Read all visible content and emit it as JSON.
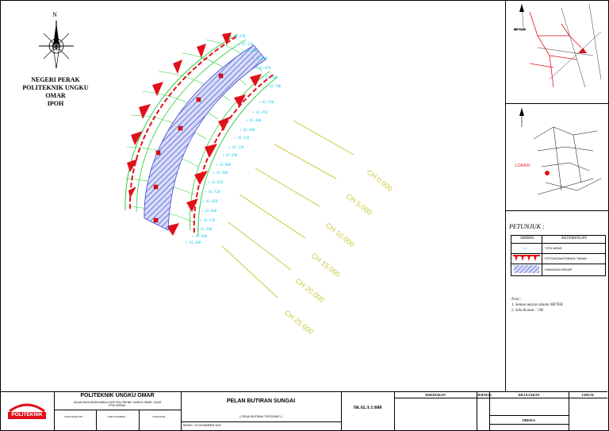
{
  "org_block": {
    "line1": "NEGERI PERAK",
    "line2": "POLITEKNIK UNGKU",
    "line3": "OMAR",
    "line4": "IPOH"
  },
  "chainages": [
    {
      "label": "CH 0.000"
    },
    {
      "label": "CH 5.000"
    },
    {
      "label": "CH 10.000"
    },
    {
      "label": "CH 15.000"
    },
    {
      "label": "CH 20.000"
    },
    {
      "label": "CH 25.000"
    }
  ],
  "location_label": "LOKASI",
  "legend": {
    "title": "PETUNJUK :",
    "header_symbol": "SIMBOL",
    "header_desc": "KETERANGAN",
    "rows": [
      {
        "desc": "TITIK ARAS"
      },
      {
        "desc": "POTONGAN/TEBING TANAH"
      },
      {
        "desc": "KAWASAN REKAP"
      }
    ]
  },
  "notes": {
    "heading": "Nota :",
    "line1": "1. Semua ukuran dalam METER",
    "line2": "2. Sela Kontur : 5M"
  },
  "title_block": {
    "org_name": "POLITEKNIK UNGKU OMAR",
    "org_address": "JALAN RAJA MUDA ABDUL AZIZ POLITEKNIK UNGKU OMAR, 31400 IPOH PERAK",
    "logo_text": "POLITEKNIK",
    "drawing_title": "PELAN BUTIRAN SUNGAI",
    "drawing_subtitle": "( PELAN BUTIRAN TOPOGRAFI )",
    "date_label": "TARIKH : 20 NOVEMBER 2022",
    "scale_text": "SKALA 1:600",
    "col_headers": [
      "DISEDIAKAN",
      "DISEMAK",
      "DILULUSKAN",
      "JADUAL"
    ],
    "col_sub": "DIREKA",
    "row_labels": [
      "NUR ATIQAH BT ...",
      "NUR SYAHIRAH ...",
      "NUR FATIN ..."
    ],
    "subrow_labels": [
      "SUKATAN",
      "KEMASKINI"
    ]
  }
}
